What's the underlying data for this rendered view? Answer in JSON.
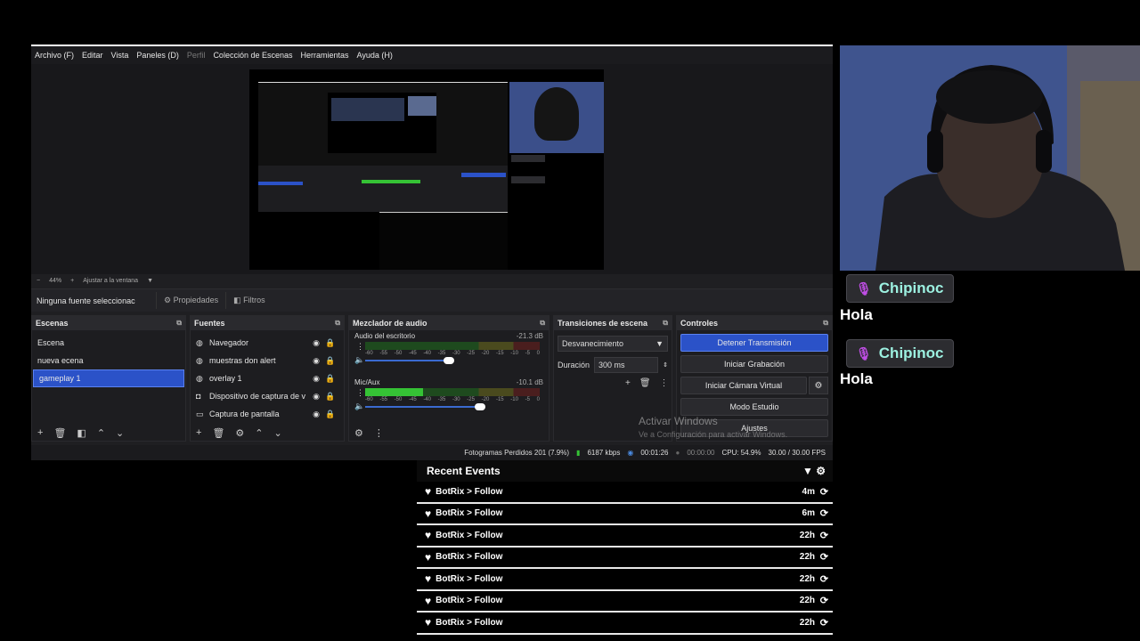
{
  "menu": {
    "items": [
      "Archivo (F)",
      "Editar",
      "Vista",
      "Paneles (D)",
      "Perfil",
      "Colección de Escenas",
      "Herramientas",
      "Ayuda (H)"
    ]
  },
  "zoom": {
    "minus": "−",
    "level": "44%",
    "plus": "+",
    "fit": "Ajustar a la ventana"
  },
  "props_bar": {
    "no_source": "Ninguna fuente seleccionac",
    "properties": "Propiedades",
    "filters": "Filtros"
  },
  "scenes": {
    "title": "Escenas",
    "items": [
      {
        "label": "Escena"
      },
      {
        "label": "nueva ecena"
      },
      {
        "label": "gameplay 1"
      }
    ],
    "active_index": 2
  },
  "sources": {
    "title": "Fuentes",
    "items": [
      {
        "label": "Navegador"
      },
      {
        "label": "muestras don alert"
      },
      {
        "label": "overlay 1"
      },
      {
        "label": "Dispositivo de captura de v"
      },
      {
        "label": "Captura de pantalla"
      }
    ]
  },
  "mixer": {
    "title": "Mezclador de audio",
    "channels": [
      {
        "name": "Audio del escritorio",
        "db": "-21.3 dB",
        "level": 0,
        "fader": 0.48
      },
      {
        "name": "Mic/Aux",
        "db": "-10.1 dB",
        "level": 0.33,
        "fader": 0.66
      }
    ],
    "ticks": [
      "-60",
      "-55",
      "-50",
      "-45",
      "-40",
      "-35",
      "-30",
      "-25",
      "-20",
      "-15",
      "-10",
      "-5",
      "0"
    ]
  },
  "transitions": {
    "title": "Transiciones de escena",
    "selected": "Desvanecimiento",
    "duration_label": "Duración",
    "duration_value": "300 ms"
  },
  "controls": {
    "title": "Controles",
    "stop_stream": "Detener Transmisión",
    "start_recording": "Iniciar Grabación",
    "start_vcam": "Iniciar Cámara Virtual",
    "studio_mode": "Modo Estudio",
    "settings": "Ajustes"
  },
  "status": {
    "dropped": "Fotogramas Perdidos 201 (7.9%)",
    "bitrate": "6187 kbps",
    "stream_time": "00:01:26",
    "rec_time": "00:00:00",
    "cpu": "CPU: 54.9%",
    "fps": "30.00 / 30.00 FPS"
  },
  "watermark": {
    "title": "Activar Windows",
    "subtitle": "Ve a Configuración para activar Windows."
  },
  "chat": [
    {
      "user": "Chipinoc",
      "message": "Hola"
    },
    {
      "user": "Chipinoc",
      "message": "Hola"
    }
  ],
  "events": {
    "title": "Recent Events",
    "rows": [
      {
        "text": "BotRix > Follow",
        "ago": "4m"
      },
      {
        "text": "BotRix > Follow",
        "ago": "6m"
      },
      {
        "text": "BotRix > Follow",
        "ago": "22h"
      },
      {
        "text": "BotRix > Follow",
        "ago": "22h"
      },
      {
        "text": "BotRix > Follow",
        "ago": "22h"
      },
      {
        "text": "BotRix > Follow",
        "ago": "22h"
      },
      {
        "text": "BotRix > Follow",
        "ago": "22h"
      }
    ]
  },
  "colors": {
    "accent": "#2b52c8",
    "meter_green": "#35c235",
    "chat_name": "#9cf0e0",
    "mic_icon": "#c04ee6"
  }
}
